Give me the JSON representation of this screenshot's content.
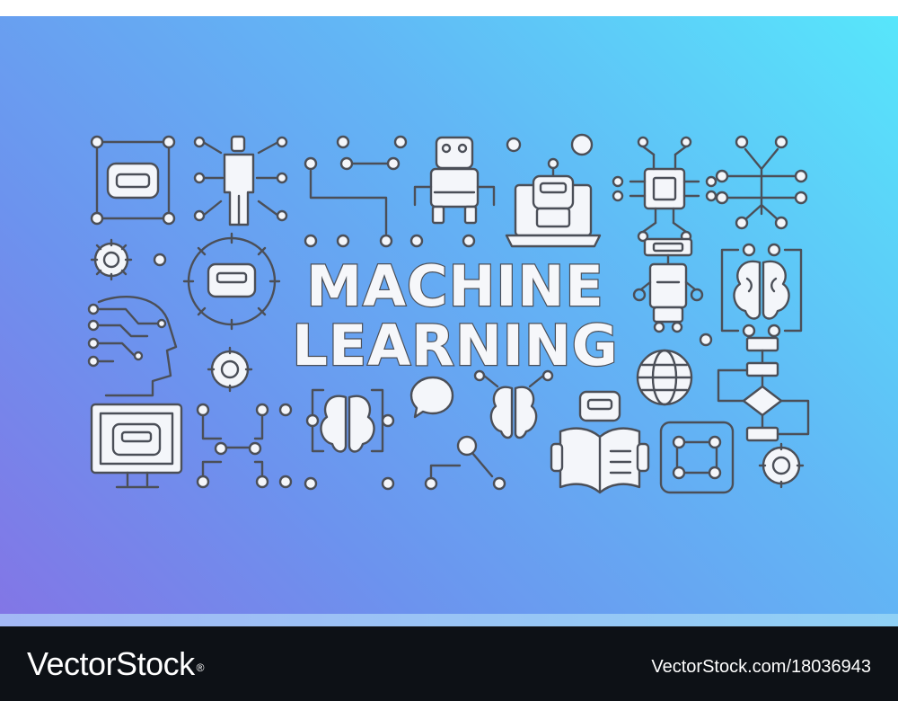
{
  "banner": {
    "title_line1": "MACHINE",
    "title_line2": "LEARNING",
    "gradient_colors": [
      "#57e6fb",
      "#62b6f5",
      "#6c93ee",
      "#8276e6"
    ],
    "outline_color": "#4b4f58",
    "fill_color": "#f4f6fa"
  },
  "footer": {
    "logo_text": "VectorStock",
    "logo_mark": "®",
    "image_id": "VectorStock.com/18036943",
    "background": "#0d1116"
  },
  "icons": [
    "vr-headset-icon",
    "person-network-icon",
    "circuit-path-icon",
    "robot-icon",
    "laptop-robot-icon",
    "chip-icon",
    "brain-circuit-icon",
    "gear-icon",
    "gear-robot-icon",
    "head-circuit-icon",
    "tall-robot-icon",
    "brain-icon",
    "globe-icon",
    "flowchart-icon",
    "monitor-vr-icon",
    "network-nodes-icon",
    "chat-bubble-icon",
    "book-robot-icon",
    "node-frame-icon"
  ]
}
